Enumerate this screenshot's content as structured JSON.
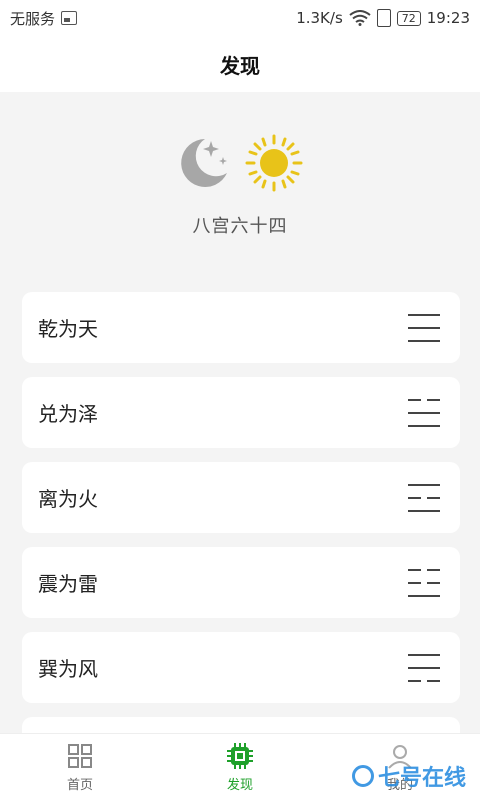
{
  "status_bar": {
    "carrier": "无服务",
    "speed": "1.3K/s",
    "battery": "72",
    "time": "19:23"
  },
  "header": {
    "title": "发现"
  },
  "hero": {
    "label": "八宫六十四"
  },
  "list": [
    {
      "label": "乾为天",
      "symbol": "qian-trigram-icon"
    },
    {
      "label": "兑为泽",
      "symbol": "dui-trigram-icon"
    },
    {
      "label": "离为火",
      "symbol": "li-trigram-icon"
    },
    {
      "label": "震为雷",
      "symbol": "zhen-trigram-icon"
    },
    {
      "label": "巽为风",
      "symbol": "xun-trigram-icon"
    }
  ],
  "tabs": [
    {
      "label": "首页",
      "active": false
    },
    {
      "label": "发现",
      "active": true
    },
    {
      "label": "我的",
      "active": false
    }
  ],
  "watermark": {
    "text": "七号在线"
  },
  "colors": {
    "accent": "#1ea02a",
    "moon": "#a7a7a7",
    "sun": "#e8c319",
    "watermark": "#2d8fe0"
  }
}
